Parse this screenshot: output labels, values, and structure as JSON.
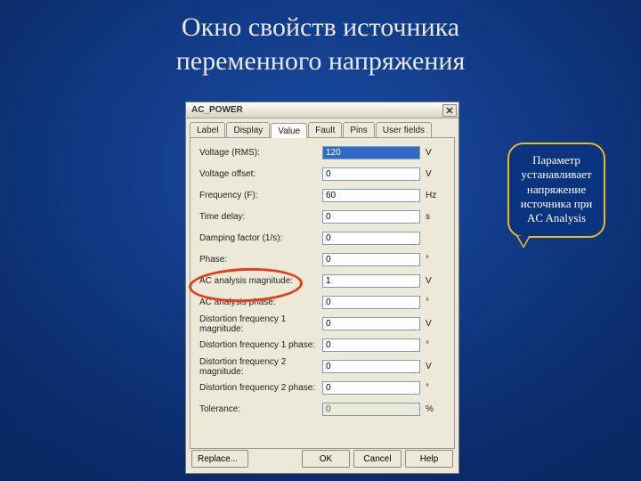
{
  "slide": {
    "title_line1": "Окно свойств источника",
    "title_line2": "переменного напряжения"
  },
  "callout": {
    "text": "Параметр устанавливает напряжение источника при AC Analysis"
  },
  "dialog": {
    "title": "AC_POWER",
    "tabs": [
      "Label",
      "Display",
      "Value",
      "Fault",
      "Pins",
      "User fields"
    ],
    "active_tab": "Value",
    "fields": [
      {
        "label": "Voltage (RMS):",
        "value": "120",
        "unit": "V",
        "selected": true
      },
      {
        "label": "Voltage offset:",
        "value": "0",
        "unit": "V"
      },
      {
        "label": "Frequency (F):",
        "value": "60",
        "unit": "Hz"
      },
      {
        "label": "Time delay:",
        "value": "0",
        "unit": "s"
      },
      {
        "label": "Damping factor (1/s):",
        "value": "0",
        "unit": ""
      },
      {
        "label": "Phase:",
        "value": "0",
        "unit": "°"
      },
      {
        "label": "AC analysis magnitude:",
        "value": "1",
        "unit": "V"
      },
      {
        "label": "AC analysis phase:",
        "value": "0",
        "unit": "°"
      },
      {
        "label": "Distortion frequency 1 magnitude:",
        "value": "0",
        "unit": "V"
      },
      {
        "label": "Distortion frequency 1 phase:",
        "value": "0",
        "unit": "°"
      },
      {
        "label": "Distortion frequency 2 magnitude:",
        "value": "0",
        "unit": "V"
      },
      {
        "label": "Distortion frequency 2 phase:",
        "value": "0",
        "unit": "°"
      },
      {
        "label": "Tolerance:",
        "value": "0",
        "unit": "%",
        "readonly": true
      }
    ],
    "buttons": {
      "replace": "Replace...",
      "ok": "OK",
      "cancel": "Cancel",
      "help": "Help"
    }
  }
}
